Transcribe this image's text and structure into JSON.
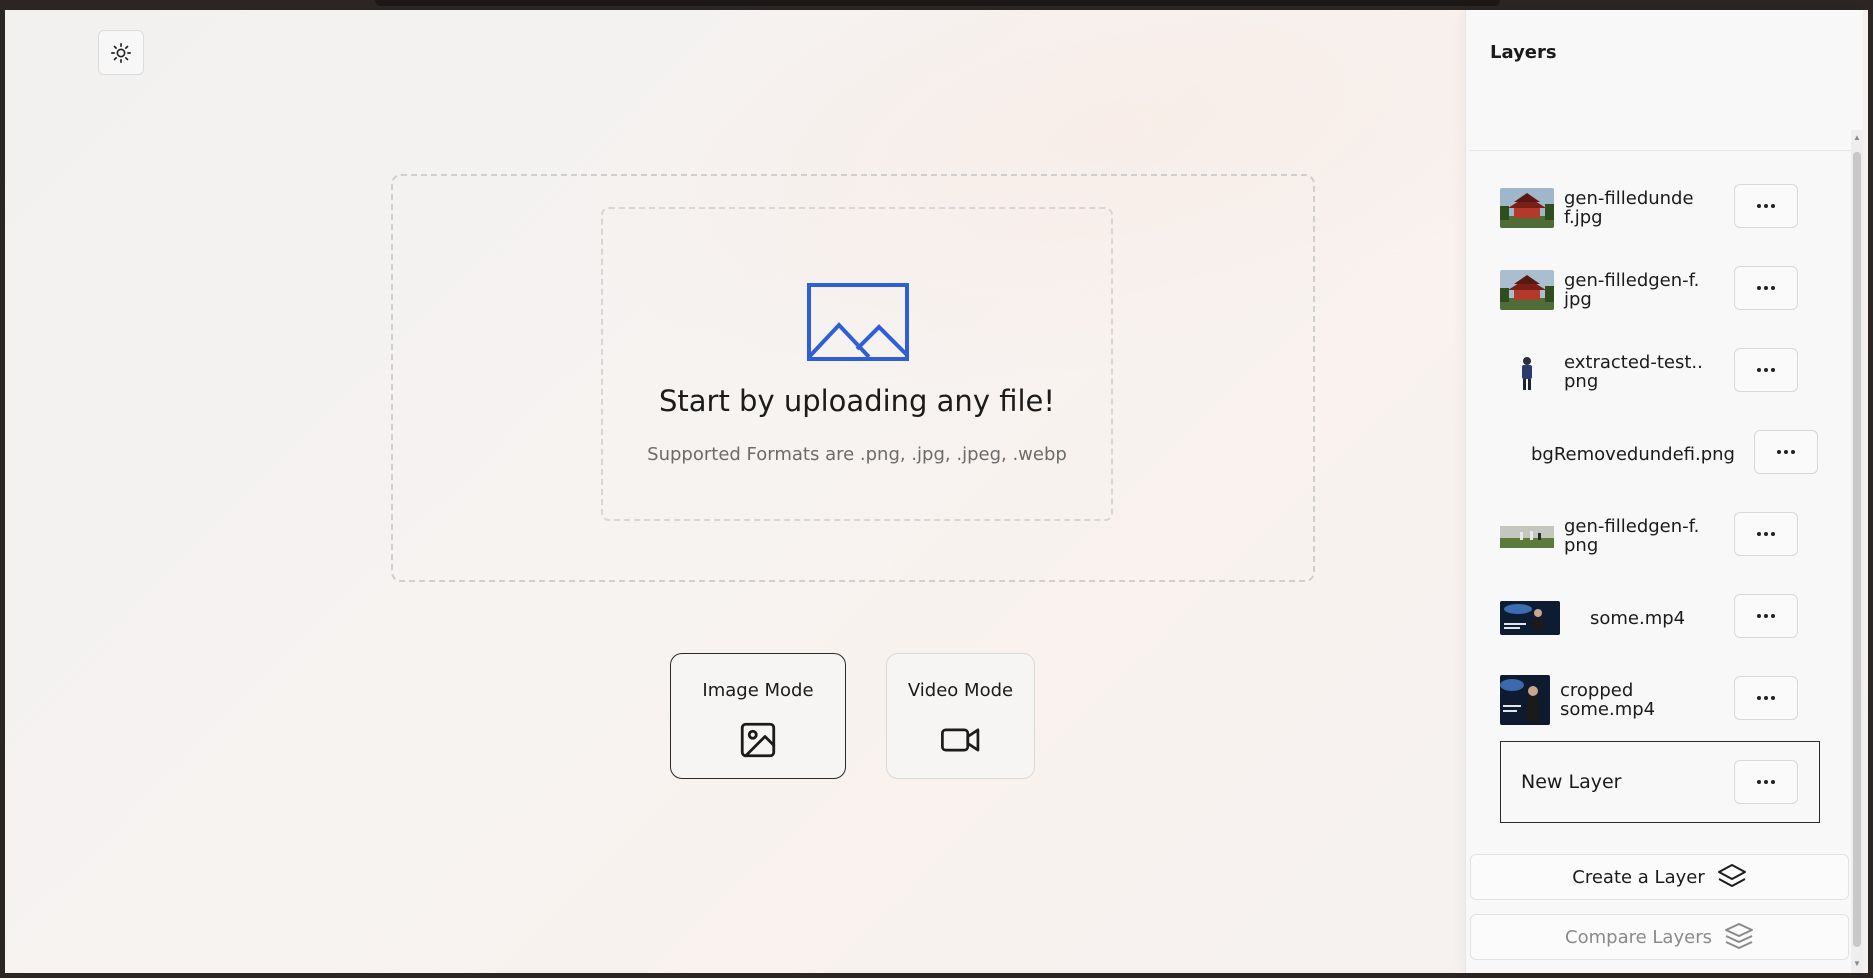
{
  "theme_toggle": {
    "icon": "sun-icon"
  },
  "upload": {
    "title": "Start by uploading any file!",
    "subtitle": "Supported Formats are .png, .jpg, .jpeg, .webp",
    "icon": "image-icon",
    "accent_color": "#2f5fd6"
  },
  "modes": {
    "image": {
      "label": "Image Mode",
      "icon": "image-icon"
    },
    "video": {
      "label": "Video Mode",
      "icon": "video-camera-icon"
    }
  },
  "panel": {
    "title": "Layers",
    "layers": [
      {
        "name": "gen-filledundef.jpg",
        "thumb": "pagoda"
      },
      {
        "name": "gen-filledgen-f.jpg",
        "thumb": "pagoda"
      },
      {
        "name": "extracted-test..png",
        "thumb": "person"
      },
      {
        "name": "bgRemovedundefi.png",
        "thumb": "none"
      },
      {
        "name": "gen-filledgen-f.png",
        "thumb": "field"
      },
      {
        "name": "some.mp4",
        "thumb": "video"
      },
      {
        "name": "cropped some.mp4",
        "thumb": "video-crop"
      }
    ],
    "new_layer": "New Layer",
    "create_button": "Create a Layer",
    "compare_button": "Compare Layers"
  }
}
